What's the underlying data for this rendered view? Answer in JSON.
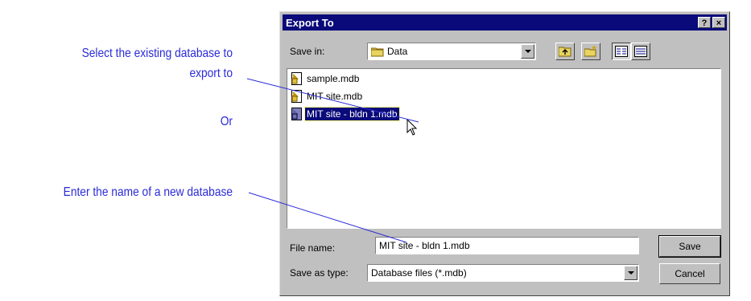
{
  "annotations": {
    "select_line1": "Select the existing database to",
    "select_line2": "export to",
    "or": "Or",
    "enter": "Enter the name of a new database"
  },
  "dialog": {
    "title": "Export To",
    "help_btn": "?",
    "close_btn": "×",
    "save_in_label": "Save in:",
    "save_in_value": "Data",
    "toolbar": [
      "up-one-level-icon",
      "new-folder-icon",
      "list-view-icon",
      "details-view-icon"
    ],
    "files": [
      {
        "name": "sample.mdb",
        "icon": "database-file-icon",
        "selected": false
      },
      {
        "name": "MIT site.mdb",
        "icon": "database-file-icon",
        "selected": false
      },
      {
        "name": "MIT site - bldn 1.mdb",
        "icon": "database-file-icon",
        "selected": true
      }
    ],
    "file_name_label": "File name:",
    "file_name_value": "MIT site - bldn 1.mdb",
    "save_as_type_label": "Save as type:",
    "save_as_type_value": "Database files (*.mdb)",
    "save_button": "Save",
    "cancel_button": "Cancel"
  },
  "colors": {
    "annotation": "#2b2bd8",
    "titlebar": "#0a0a7a",
    "dialog_bg": "#c0c0c0"
  }
}
